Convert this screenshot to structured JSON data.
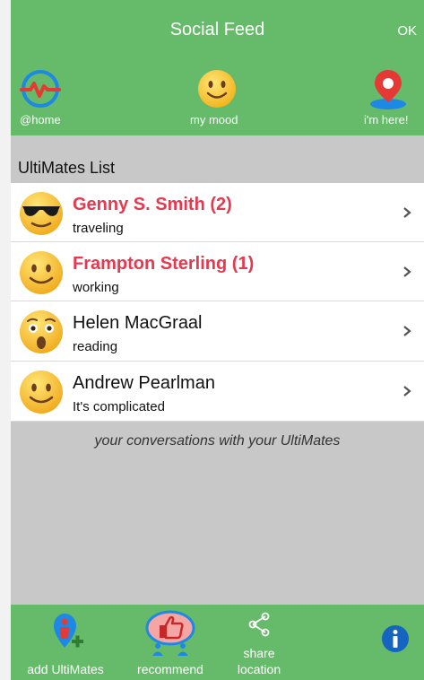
{
  "header": {
    "title": "Social Feed",
    "ok_label": "OK"
  },
  "top_actions": [
    {
      "label": "@home",
      "icon": "heartbeat-icon"
    },
    {
      "label": "my mood",
      "icon": "smiley-icon"
    },
    {
      "label": "i'm here!",
      "icon": "location-pin-icon"
    }
  ],
  "list": {
    "title": "UltiMates List",
    "items": [
      {
        "name": "Genny S. Smith (2)",
        "status": "traveling",
        "unread": true,
        "mood": "sunglasses"
      },
      {
        "name": "Frampton Sterling (1)",
        "status": "working",
        "unread": true,
        "mood": "smile"
      },
      {
        "name": "Helen MacGraal",
        "status": "reading",
        "unread": false,
        "mood": "surprised"
      },
      {
        "name": "Andrew Pearlman",
        "status": "It's complicated",
        "unread": false,
        "mood": "smile"
      }
    ]
  },
  "conversations_text": "your conversations with your UltiMates",
  "bottom_actions": [
    {
      "label": "add UltiMates",
      "icon": "add-user-icon"
    },
    {
      "label": "recommend",
      "icon": "thumbs-up-icon"
    },
    {
      "label_line1": "share",
      "label_line2": "location",
      "icon": "share-icon"
    },
    {
      "icon": "info-icon"
    }
  ],
  "colors": {
    "bar_green": "#66bb6a",
    "unread_red": "#e53950",
    "background_gray": "#c8c8c8"
  }
}
